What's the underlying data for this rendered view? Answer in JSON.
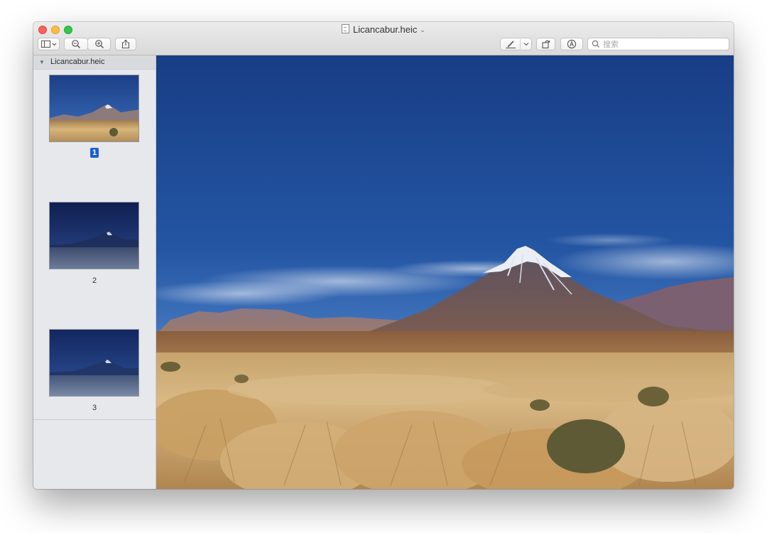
{
  "window": {
    "title": "Licancabur.heic"
  },
  "toolbar": {
    "sidebar_icon": "sidebar-toggle-icon",
    "zoom_out_icon": "zoom-out-icon",
    "zoom_in_icon": "zoom-in-icon",
    "share_icon": "share-icon",
    "markup_icon": "pen-icon",
    "rotate_icon": "rotate-icon",
    "annotate_icon": "markup-circle-icon",
    "search_placeholder": "搜索"
  },
  "sidebar": {
    "group_label": "Licancabur.heic",
    "pages": [
      {
        "number": "1",
        "selected": true
      },
      {
        "number": "2",
        "selected": false
      },
      {
        "number": "3",
        "selected": false
      }
    ]
  },
  "colors": {
    "selection": "#1b5fd6",
    "sky_top": "#1a3f86",
    "sky_bottom": "#5d8ccc",
    "grass": "#c9a466"
  }
}
